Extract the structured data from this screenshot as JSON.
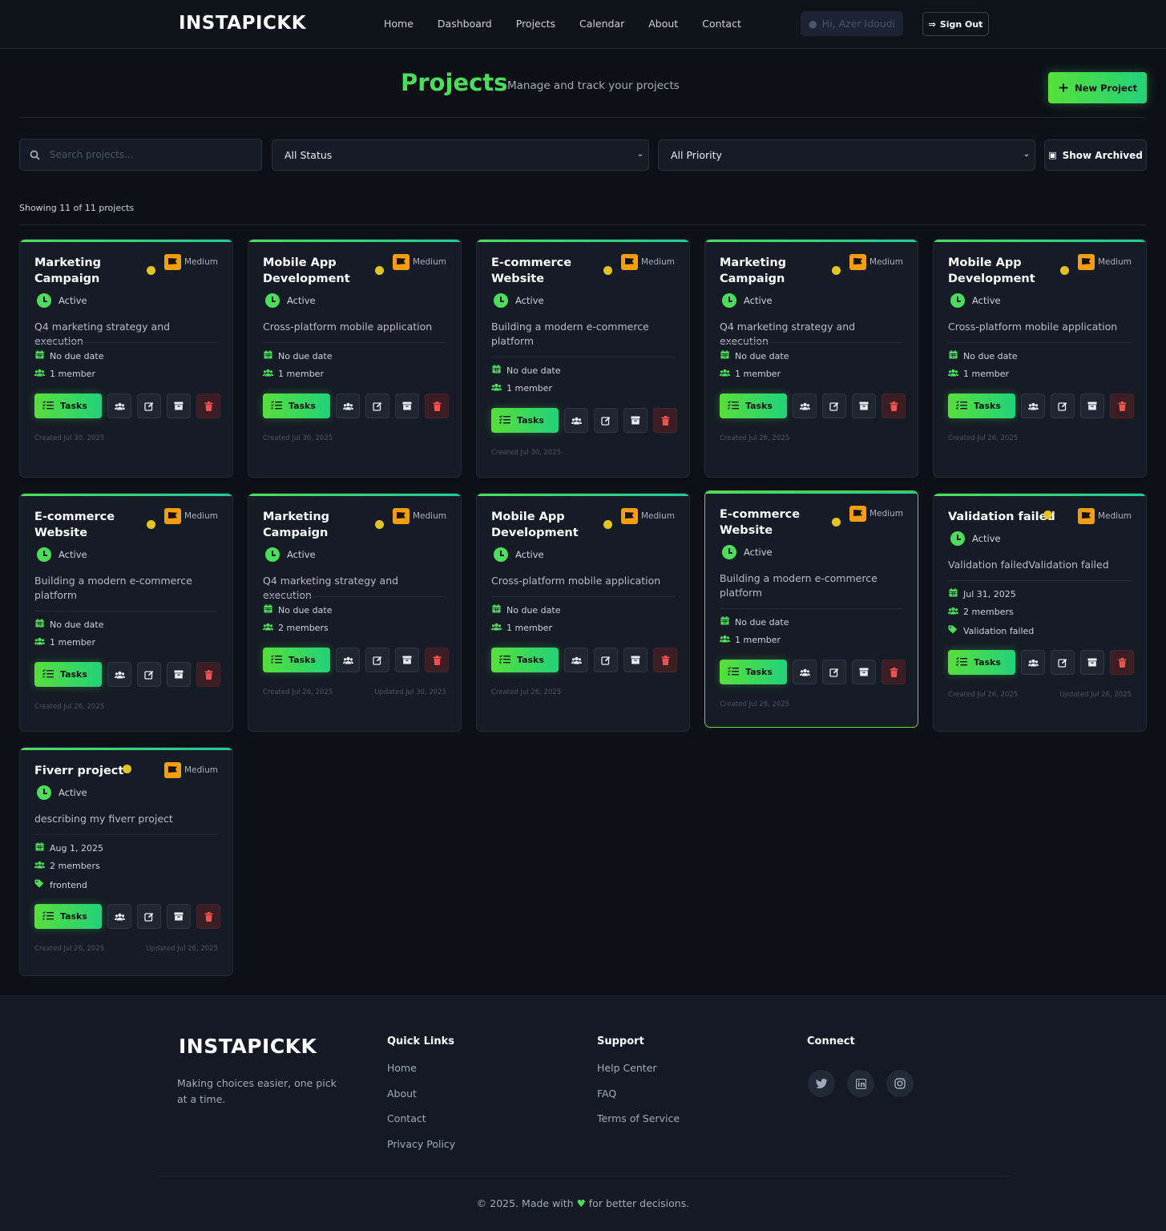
{
  "nav": {
    "logo": "INSTAPICKK",
    "links": [
      "Home",
      "Dashboard",
      "Projects",
      "Calendar",
      "About",
      "Contact"
    ],
    "user_greeting": "Hi, Azer Idoudi",
    "signout_label": "Sign Out"
  },
  "header": {
    "title": "Projects",
    "subtitle": "Manage and track your projects",
    "new_button": "New Project"
  },
  "filters": {
    "search_placeholder": "Search projects...",
    "status_selected": "All Status",
    "priority_selected": "All Priority",
    "archived_button": "Show Archived"
  },
  "showing_text": "Showing 11 of 11 projects",
  "colors": {
    "accent": "#4ade5a",
    "priority_medium": "#f59e0b",
    "status_dot": "#e5c422",
    "danger": "#f05252"
  },
  "tasks_label": "Tasks",
  "projects": [
    {
      "title": "Marketing Campaign",
      "priority": "Medium",
      "status": "Active",
      "description": "Q4 marketing strategy and execution",
      "due": "No due date",
      "members": "1 member",
      "tag": "",
      "created": "Created Jul 30, 2025",
      "updated": ""
    },
    {
      "title": "Mobile App Development",
      "priority": "Medium",
      "status": "Active",
      "description": "Cross-platform mobile application",
      "due": "No due date",
      "members": "1 member",
      "tag": "",
      "created": "Created Jul 30, 2025",
      "updated": ""
    },
    {
      "title": "E-commerce Website",
      "priority": "Medium",
      "status": "Active",
      "description": "Building a modern e-commerce platform",
      "due": "No due date",
      "members": "1 member",
      "tag": "",
      "created": "Created Jul 30, 2025",
      "updated": ""
    },
    {
      "title": "Marketing Campaign",
      "priority": "Medium",
      "status": "Active",
      "description": "Q4 marketing strategy and execution",
      "due": "No due date",
      "members": "1 member",
      "tag": "",
      "created": "Created Jul 26, 2025",
      "updated": ""
    },
    {
      "title": "Mobile App Development",
      "priority": "Medium",
      "status": "Active",
      "description": "Cross-platform mobile application",
      "due": "No due date",
      "members": "1 member",
      "tag": "",
      "created": "Created Jul 26, 2025",
      "updated": ""
    },
    {
      "title": "E-commerce Website",
      "priority": "Medium",
      "status": "Active",
      "description": "Building a modern e-commerce platform",
      "due": "No due date",
      "members": "1 member",
      "tag": "",
      "created": "Created Jul 26, 2025",
      "updated": ""
    },
    {
      "title": "Marketing Campaign",
      "priority": "Medium",
      "status": "Active",
      "description": "Q4 marketing strategy and execution",
      "due": "No due date",
      "members": "2 members",
      "tag": "",
      "created": "Created Jul 26, 2025",
      "updated": "Updated Jul 30, 2025"
    },
    {
      "title": "Mobile App Development",
      "priority": "Medium",
      "status": "Active",
      "description": "Cross-platform mobile application",
      "due": "No due date",
      "members": "1 member",
      "tag": "",
      "created": "Created Jul 26, 2025",
      "updated": ""
    },
    {
      "title": "E-commerce Website",
      "priority": "Medium",
      "status": "Active",
      "description": "Building a modern e-commerce platform",
      "due": "No due date",
      "members": "1 member",
      "tag": "",
      "created": "Created Jul 26, 2025",
      "updated": ""
    },
    {
      "title": "Validation failed",
      "priority": "Medium",
      "status": "Active",
      "description": "Validation failedValidation failed",
      "due": "Jul 31, 2025",
      "members": "2 members",
      "tag": "Validation failed",
      "created": "Created Jul 26, 2025",
      "updated": "Updated Jul 26, 2025"
    },
    {
      "title": "Fiverr project",
      "priority": "Medium",
      "status": "Active",
      "description": "describing my fiverr project",
      "due": "Aug 1, 2025",
      "members": "2 members",
      "tag": "frontend",
      "created": "Created Jul 26, 2025",
      "updated": "Updated Jul 26, 2025"
    }
  ],
  "footer": {
    "logo": "INSTAPICKK",
    "tagline": "Making choices easier, one pick at a time.",
    "quick_links_title": "Quick Links",
    "quick_links": [
      "Home",
      "About",
      "Contact",
      "Privacy Policy"
    ],
    "support_title": "Support",
    "support_links": [
      "Help Center",
      "FAQ",
      "Terms of Service"
    ],
    "connect_title": "Connect",
    "social_icons": [
      "twitter-icon",
      "linkedin-icon",
      "instagram-icon"
    ],
    "copyright_prefix": "© 2025. Made with",
    "copyright_suffix": "for better decisions."
  }
}
